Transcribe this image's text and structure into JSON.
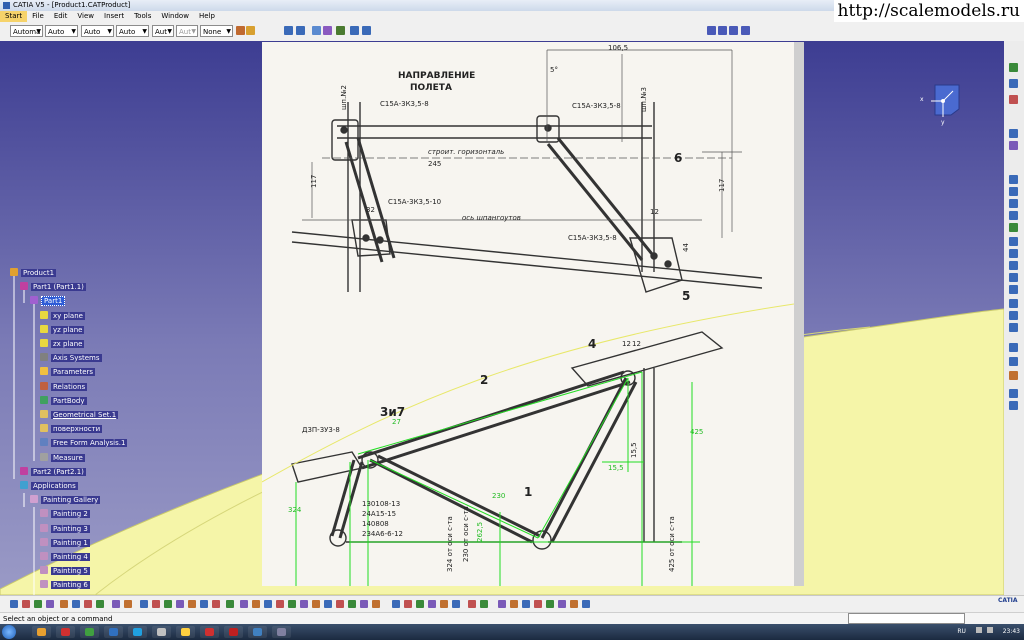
{
  "window": {
    "title": "CATIA V5 - [Product1.CATProduct]"
  },
  "watermark": "http://scalemodels.ru",
  "menu": [
    "Start",
    "File",
    "Edit",
    "View",
    "Insert",
    "Tools",
    "Window",
    "Help"
  ],
  "toolbar": {
    "combos": [
      {
        "value": "Automa",
        "disabled": false
      },
      {
        "value": "Auto",
        "disabled": false
      },
      {
        "value": "Auto",
        "disabled": false
      },
      {
        "value": "Auto",
        "disabled": false
      },
      {
        "value": "Aut",
        "disabled": false
      },
      {
        "value": "Aut",
        "disabled": true
      },
      {
        "value": "None",
        "disabled": false
      }
    ]
  },
  "compass": {
    "x": "x",
    "y": "y"
  },
  "tree": [
    {
      "label": "Product1",
      "level": 0,
      "icon": "product-icon",
      "style": ""
    },
    {
      "label": "Part1 (Part1.1)",
      "level": 1,
      "icon": "part-instance-icon",
      "style": ""
    },
    {
      "label": "Part1",
      "level": 2,
      "icon": "part-icon",
      "style": "hl"
    },
    {
      "label": "xy plane",
      "level": 3,
      "icon": "plane-icon",
      "style": ""
    },
    {
      "label": "yz plane",
      "level": 3,
      "icon": "plane-icon",
      "style": ""
    },
    {
      "label": "zx plane",
      "level": 3,
      "icon": "plane-icon",
      "style": ""
    },
    {
      "label": "Axis Systems",
      "level": 3,
      "icon": "axis-system-icon",
      "style": ""
    },
    {
      "label": "Parameters",
      "level": 3,
      "icon": "parameters-icon",
      "style": ""
    },
    {
      "label": "Relations",
      "level": 3,
      "icon": "relations-icon",
      "style": ""
    },
    {
      "label": "PartBody",
      "level": 3,
      "icon": "partbody-icon",
      "style": ""
    },
    {
      "label": "Geometrical Set.1",
      "level": 3,
      "icon": "geometrical-set-icon",
      "style": "ul"
    },
    {
      "label": "поверхности",
      "level": 3,
      "icon": "geometrical-set-icon",
      "style": ""
    },
    {
      "label": "Free Form Analysis.1",
      "level": 3,
      "icon": "analysis-icon",
      "style": ""
    },
    {
      "label": "Measure",
      "level": 3,
      "icon": "measure-icon",
      "style": ""
    },
    {
      "label": "Part2 (Part2.1)",
      "level": 1,
      "icon": "part-instance-icon",
      "style": ""
    },
    {
      "label": "Applications",
      "level": 1,
      "icon": "applications-icon",
      "style": ""
    },
    {
      "label": "Painting Gallery",
      "level": 2,
      "icon": "gallery-icon",
      "style": ""
    },
    {
      "label": "Painting 2",
      "level": 3,
      "icon": "painting-icon",
      "style": ""
    },
    {
      "label": "Painting 3",
      "level": 3,
      "icon": "painting-icon",
      "style": ""
    },
    {
      "label": "Painting 1",
      "level": 3,
      "icon": "painting-icon",
      "style": ""
    },
    {
      "label": "Painting 4",
      "level": 3,
      "icon": "painting-icon",
      "style": ""
    },
    {
      "label": "Painting 5",
      "level": 3,
      "icon": "painting-icon",
      "style": ""
    },
    {
      "label": "Painting 6",
      "level": 3,
      "icon": "painting-icon",
      "style": ""
    }
  ],
  "drawing": {
    "heading_1": "НАПРАВЛЕНИЕ",
    "heading_2": "ПОЛЕТА",
    "top_labels": {
      "bolt_1": "С15А-3К3,5-8",
      "bolt_2": "С15А-3К3,5-8",
      "bolt_3": "С15А-3К3,5-10",
      "bolt_4": "С15А-3К3,5-8",
      "frame_2": "шп.№2",
      "frame_3": "шп.№3",
      "horizon": "строит. горизонталь",
      "frame_axis": "ось шпангоутов",
      "dim_1065": "106,5",
      "dim_5deg": "5°",
      "dim_245": "245",
      "dim_117a": "117",
      "dim_117b": "117",
      "dim_12": "12",
      "dim_44": "44",
      "dim_32": "32",
      "callout_6": "6",
      "callout_5": "5"
    },
    "bottom_labels": {
      "callout_4": "4",
      "callout_2": "2",
      "callout_1": "1",
      "callout_3i7": "3и7",
      "bolt_main": "Д3П-3У3-8",
      "dim_27": "27",
      "dim_12a": "12",
      "dim_12b": "12",
      "dim_155a": "15,5",
      "dim_155b": "15,5",
      "dim_425": "425",
      "dim_230": "230",
      "dim_324": "324",
      "dim_2625": "262,5",
      "parts_1": "130108-13",
      "parts_2": "24A15-15",
      "parts_3": "140808",
      "parts_4": "234A6-6-12",
      "axis_note_1": "230 от оси с-та",
      "axis_note_2": "324 от оси с-та",
      "axis_note_3": "425 от оси с-та"
    }
  },
  "status": {
    "prompt": "Select an object or a command"
  },
  "catia_logo": "CATIA",
  "tray": {
    "lang": "RU",
    "time": "23:43"
  },
  "colors": {
    "viewport_top": "#3d3d92",
    "surface": "#f5f5a8",
    "overlay_green": "#22dd22",
    "selection": "#2e5bd6",
    "menu_selected": "#f6d36a"
  }
}
